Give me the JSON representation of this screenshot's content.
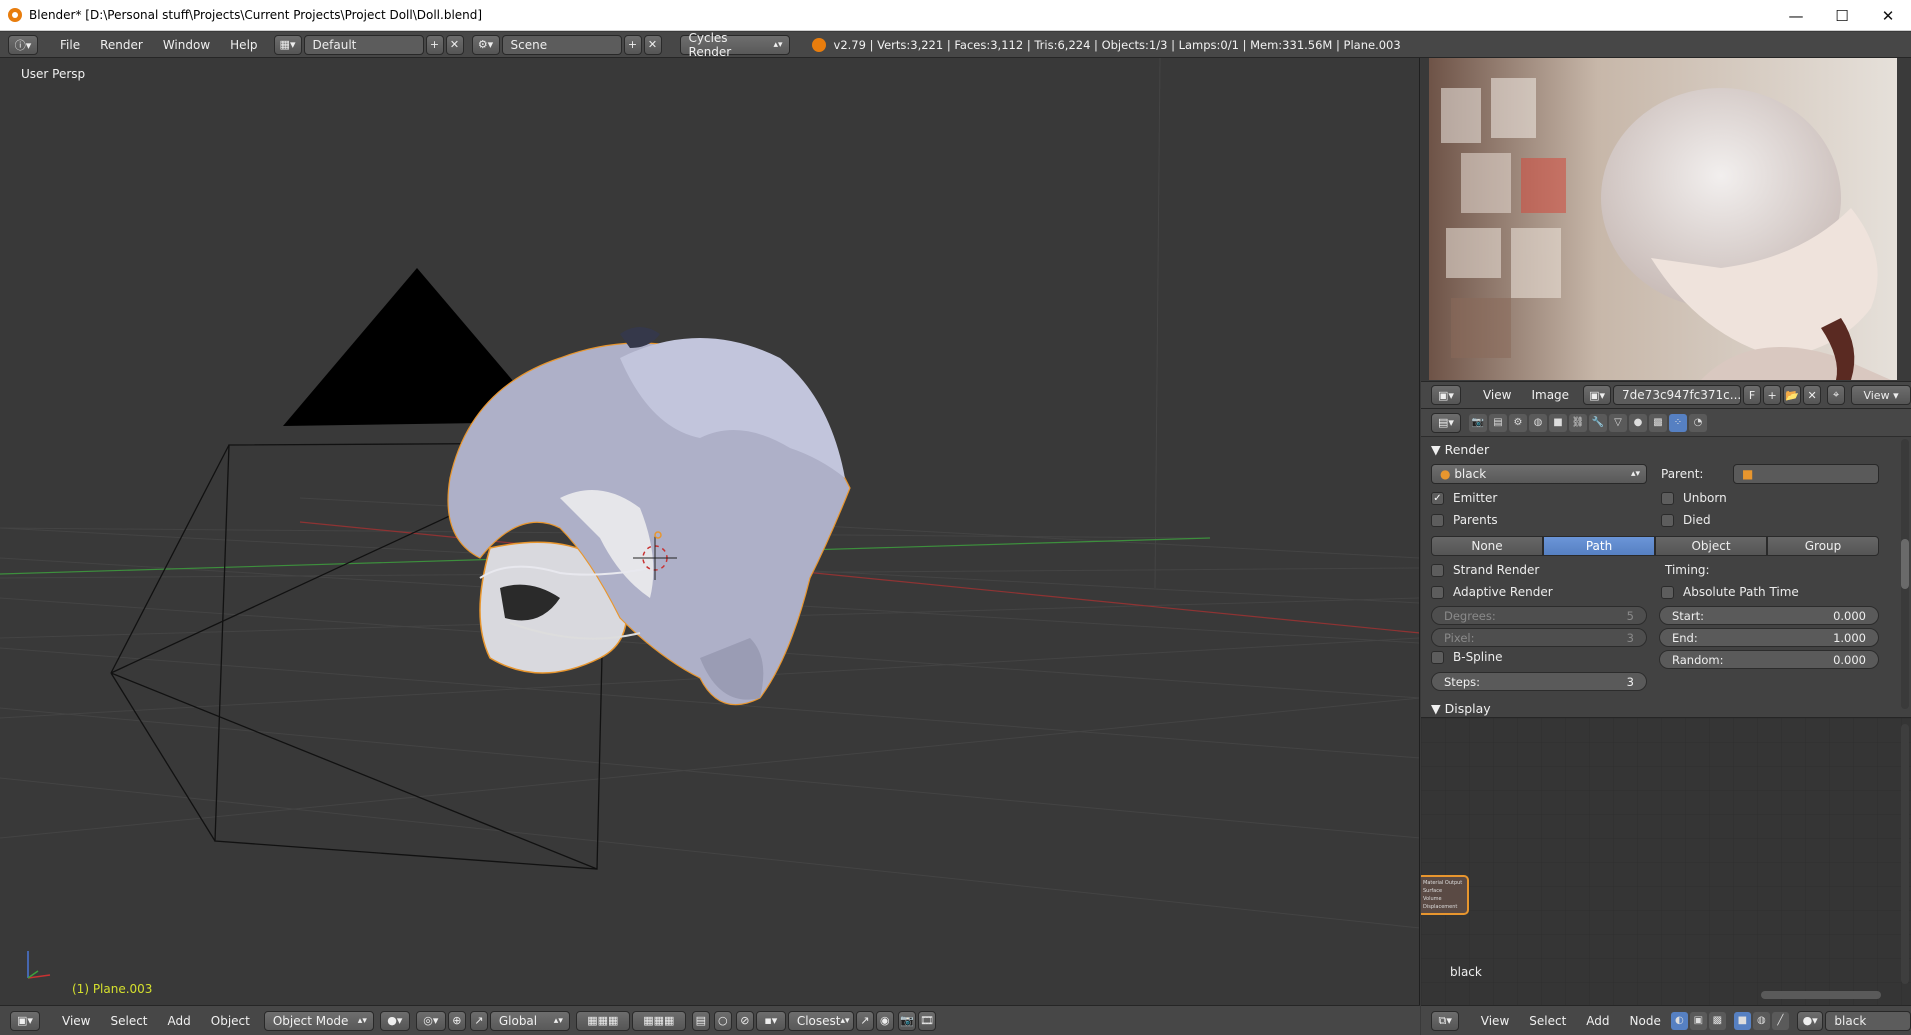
{
  "window": {
    "title": "Blender* [D:\\Personal stuff\\Projects\\Current Projects\\Project Doll\\Doll.blend]",
    "minimize": "—",
    "maximize": "☐",
    "close": "✕"
  },
  "info_header": {
    "menus": [
      "File",
      "Render",
      "Window",
      "Help"
    ],
    "layout": "Default",
    "scene": "Scene",
    "engine": "Cycles Render",
    "stats": "v2.79 | Verts:3,221 | Faces:3,112 | Tris:6,224 | Objects:1/3 | Lamps:0/1 | Mem:331.56M | Plane.003"
  },
  "viewport": {
    "view_label": "User Persp",
    "object_label": "(1) Plane.003",
    "header": {
      "menus": [
        "View",
        "Select",
        "Add",
        "Object"
      ],
      "mode": "Object Mode",
      "orientation": "Global",
      "snap": "Closest"
    }
  },
  "image_editor": {
    "menus": [
      "View",
      "Image"
    ],
    "image_name": "7de73c947fc371c...",
    "fake_user": "F",
    "view": "View"
  },
  "properties": {
    "panel_title": "Render",
    "material": "black",
    "parent_label": "Parent:",
    "emitter": "Emitter",
    "unborn": "Unborn",
    "parents": "Parents",
    "died": "Died",
    "render_as": [
      "None",
      "Path",
      "Object",
      "Group"
    ],
    "render_as_active": "Path",
    "strand_render": "Strand Render",
    "timing": "Timing:",
    "adaptive_render": "Adaptive Render",
    "absolute_path_time": "Absolute Path Time",
    "degrees_label": "Degrees:",
    "degrees_value": "5",
    "pixel_label": "Pixel:",
    "pixel_value": "3",
    "start_label": "Start:",
    "start_value": "0.000",
    "end_label": "End:",
    "end_value": "1.000",
    "random_label": "Random:",
    "random_value": "0.000",
    "bspline": "B-Spline",
    "steps_label": "Steps:",
    "steps_value": "3",
    "display_panel": "Display"
  },
  "node_editor": {
    "material_label": "black",
    "node_lines": [
      "Material Output",
      "Surface",
      "Volume",
      "Displacement"
    ],
    "menus": [
      "View",
      "Select",
      "Add",
      "Node"
    ],
    "material": "black"
  },
  "colors": {
    "accent": "#5680c2",
    "selection": "#e8962e",
    "header": "#474747",
    "viewport_bg": "#393939"
  }
}
